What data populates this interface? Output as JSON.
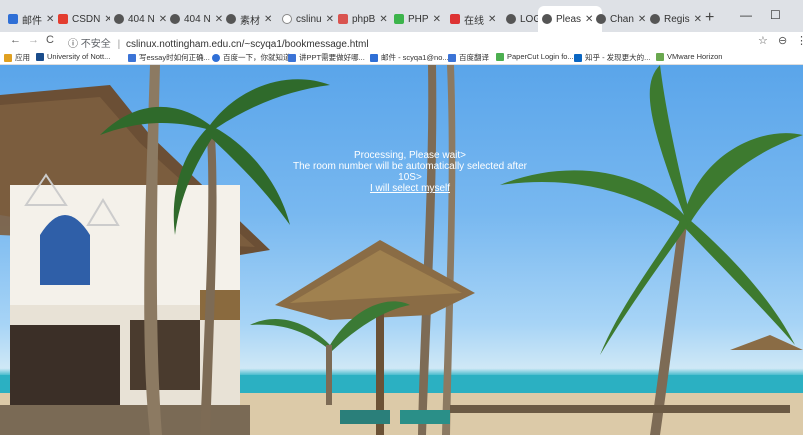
{
  "tabs": [
    {
      "label": "邮件",
      "color": "#2f6fd6"
    },
    {
      "label": "CSDN",
      "color": "#e33d2f"
    },
    {
      "label": "404 N",
      "color": "#555555"
    },
    {
      "label": "404 N",
      "color": "#555555"
    },
    {
      "label": "素材",
      "color": "#555555"
    },
    {
      "label": "cslinu",
      "color": "#888888"
    },
    {
      "label": "phpB",
      "color": "#d9534f"
    },
    {
      "label": "PHP",
      "color": "#3cb44b"
    },
    {
      "label": "在线",
      "color": "#d33"
    },
    {
      "label": "LOG I",
      "color": "#555555"
    },
    {
      "label": "Pleas",
      "color": "#555555"
    },
    {
      "label": "Chan",
      "color": "#555555"
    },
    {
      "label": "Regis",
      "color": "#555555"
    }
  ],
  "address": {
    "secure_label": "不安全",
    "url": "cslinux.nottingham.edu.cn/~scyqa1/bookmessage.html"
  },
  "bookmarks": [
    {
      "label": "应用",
      "color": "#666666"
    },
    {
      "label": "University of Nott...",
      "color": "#1a4c8b"
    },
    {
      "label": "写essay时如何正确...",
      "color": "#3b73d6"
    },
    {
      "label": "百度一下，你就知道",
      "color": "#2f6fd6"
    },
    {
      "label": "讲PPT需要做好哪...",
      "color": "#3b73d6"
    },
    {
      "label": "邮件 - scyqa1@no...",
      "color": "#2f6fd6"
    },
    {
      "label": "百度翻译",
      "color": "#3b73d6"
    },
    {
      "label": "PaperCut Login fo...",
      "color": "#4caf50"
    },
    {
      "label": "知乎 - 发现更大的...",
      "color": "#0a66c2"
    },
    {
      "label": "VMware Horizon",
      "color": "#6aa84f"
    }
  ],
  "message": {
    "line1": "Processing, Please wait>",
    "line2": "The room number will be automatically selected after 10S>",
    "link": "I will select myself"
  }
}
